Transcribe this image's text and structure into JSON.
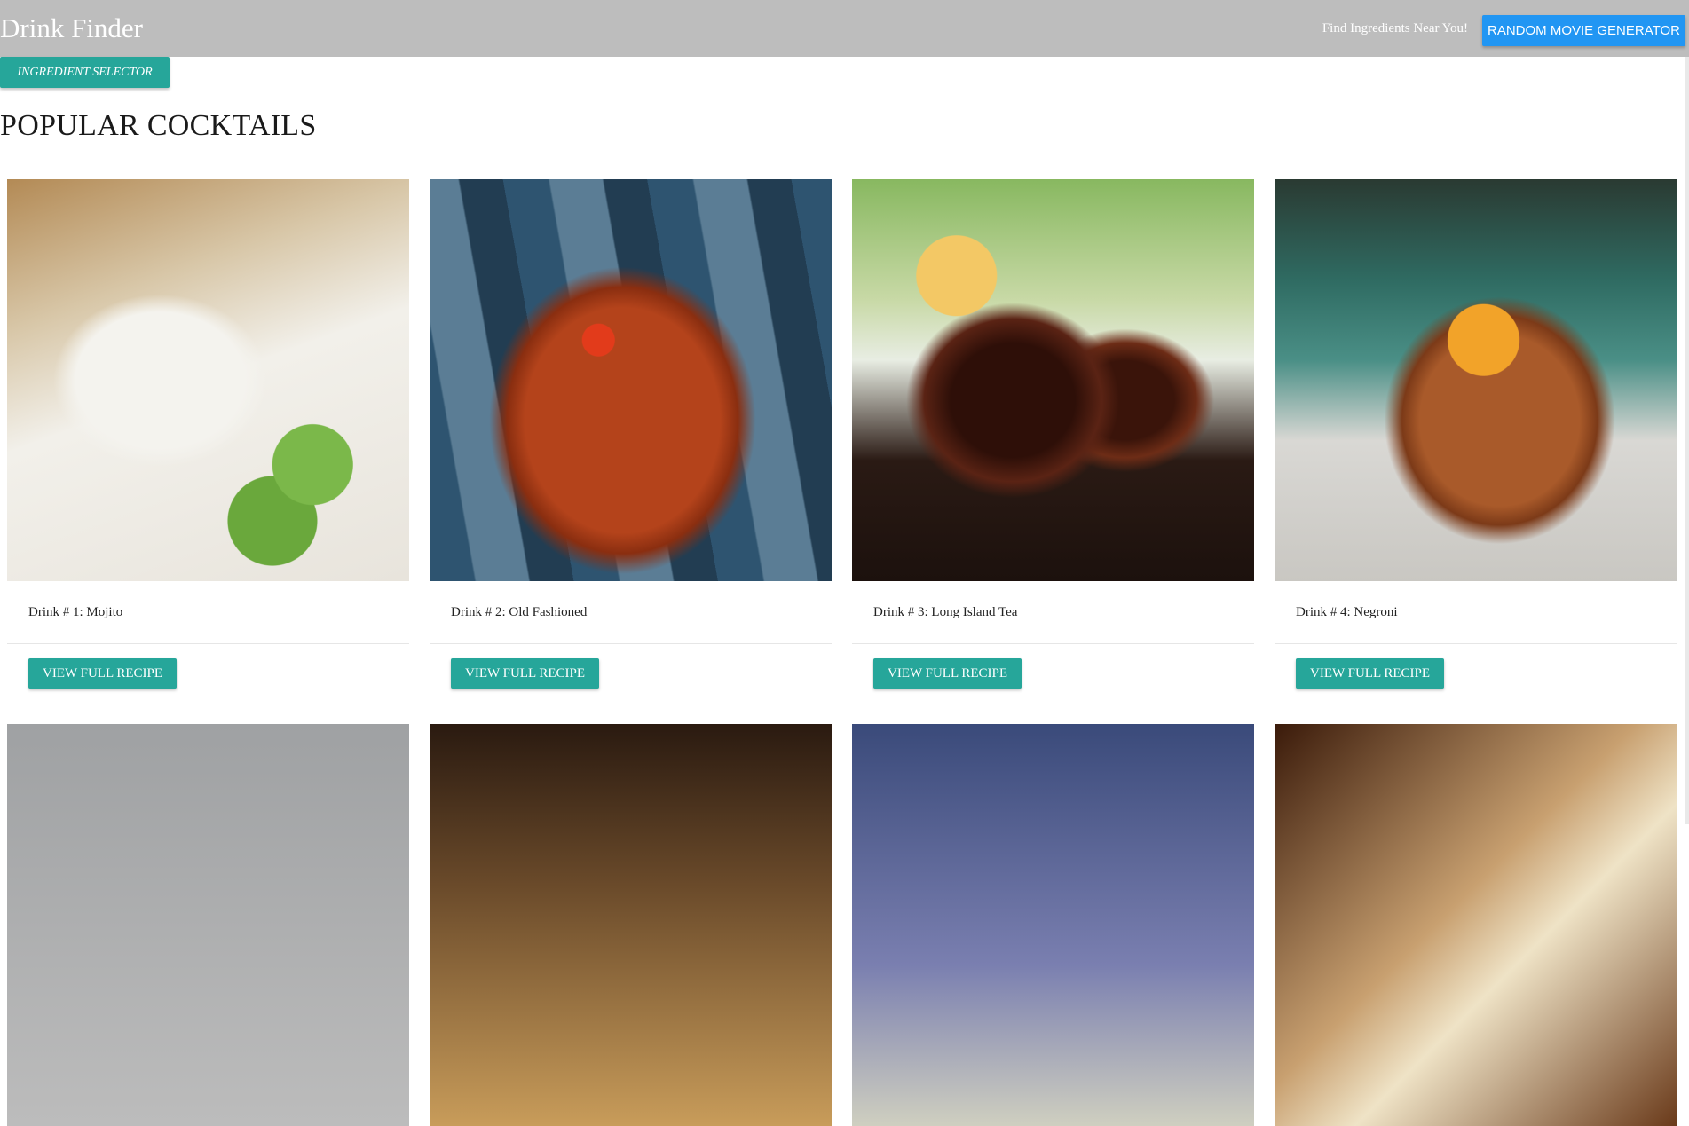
{
  "navbar": {
    "brand": "Drink Finder",
    "link": "Find Ingredients Near You!",
    "movie_button": "RANDOM MOVIE GENERATOR"
  },
  "ingredient_button": "INGREDIENT SELECTOR",
  "section_title": "POPULAR COCKTAILS",
  "cards": [
    {
      "caption": "Drink # 1: Mojito",
      "button": "VIEW FULL RECIPE",
      "image": "mojito-photo"
    },
    {
      "caption": "Drink # 2: Old Fashioned",
      "button": "VIEW FULL RECIPE",
      "image": "old-fashioned-photo"
    },
    {
      "caption": "Drink # 3: Long Island Tea",
      "button": "VIEW FULL RECIPE",
      "image": "long-island-tea-photo"
    },
    {
      "caption": "Drink # 4: Negroni",
      "button": "VIEW FULL RECIPE",
      "image": "negroni-photo"
    }
  ],
  "colors": {
    "navbar_bg": "#bdbdbd",
    "blue_button": "#2196f3",
    "teal_button": "#26a69a"
  }
}
